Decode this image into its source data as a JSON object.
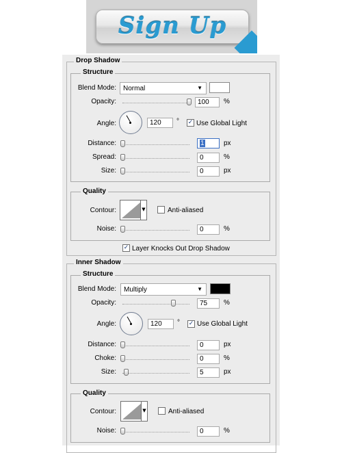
{
  "header": {
    "title": "Sign Up"
  },
  "drop_shadow": {
    "section_title": "Drop Shadow",
    "structure_title": "Structure",
    "blend_mode_label": "Blend Mode:",
    "blend_mode_value": "Normal",
    "color": "#ffffff",
    "opacity_label": "Opacity:",
    "opacity_value": "100",
    "opacity_unit": "%",
    "opacity_level": 1.0,
    "angle_label": "Angle:",
    "angle_value": "120",
    "angle_unit": "°",
    "global_light_label": "Use Global Light",
    "global_light_checked": true,
    "distance_label": "Distance:",
    "distance_value": "1",
    "distance_unit": "px",
    "distance_level": 0.0,
    "spread_label": "Spread:",
    "spread_value": "0",
    "spread_unit": "%",
    "spread_level": 0.0,
    "size_label": "Size:",
    "size_value": "0",
    "size_unit": "px",
    "size_level": 0.0,
    "quality_title": "Quality",
    "contour_label": "Contour:",
    "anti_aliased_label": "Anti-aliased",
    "anti_aliased_checked": false,
    "noise_label": "Noise:",
    "noise_value": "0",
    "noise_unit": "%",
    "noise_level": 0.0,
    "knocks_out_label": "Layer Knocks Out Drop Shadow",
    "knocks_out_checked": true
  },
  "inner_shadow": {
    "section_title": "Inner Shadow",
    "structure_title": "Structure",
    "blend_mode_label": "Blend Mode:",
    "blend_mode_value": "Multiply",
    "color": "#000000",
    "opacity_label": "Opacity:",
    "opacity_value": "75",
    "opacity_unit": "%",
    "opacity_level": 0.75,
    "angle_label": "Angle:",
    "angle_value": "120",
    "angle_unit": "°",
    "global_light_label": "Use Global Light",
    "global_light_checked": true,
    "distance_label": "Distance:",
    "distance_value": "0",
    "distance_unit": "px",
    "distance_level": 0.0,
    "choke_label": "Choke:",
    "choke_value": "0",
    "choke_unit": "%",
    "choke_level": 0.0,
    "size_label": "Size:",
    "size_value": "5",
    "size_unit": "px",
    "size_level": 0.05,
    "quality_title": "Quality",
    "contour_label": "Contour:",
    "anti_aliased_label": "Anti-aliased",
    "anti_aliased_checked": false,
    "noise_label": "Noise:",
    "noise_value": "0",
    "noise_unit": "%",
    "noise_level": 0.0
  },
  "check_mark": "✓",
  "dropdown_arrow": "▼"
}
